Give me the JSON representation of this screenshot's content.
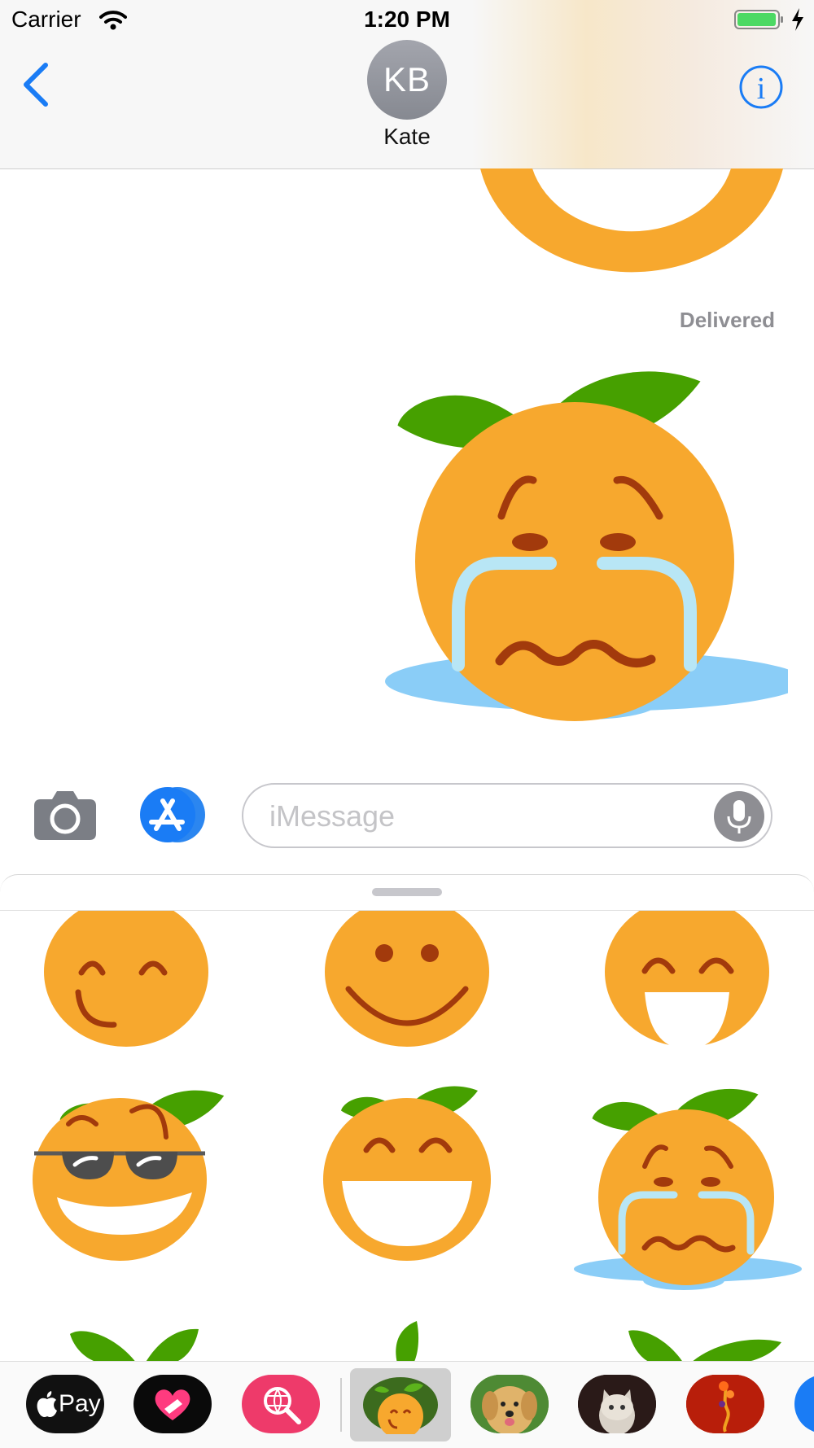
{
  "status_bar": {
    "carrier": "Carrier",
    "time": "1:20 PM"
  },
  "header": {
    "avatar_initials": "KB",
    "contact_name": "Kate"
  },
  "conversation": {
    "delivery_status": "Delivered"
  },
  "compose": {
    "placeholder": "iMessage",
    "value": ""
  },
  "app_strip": {
    "apple_pay_label": "Pay"
  },
  "colors": {
    "accent": "#1a7cf5",
    "orange": "#f7a82e",
    "leaf": "#46a000",
    "feature_brown": "#a23a0c",
    "tear": "#b8e6f5",
    "puddle": "#8acdf7"
  },
  "icons": [
    "wifi-icon",
    "battery-icon",
    "charging-bolt-icon",
    "back-chevron-icon",
    "info-icon",
    "camera-icon",
    "app-store-icon",
    "microphone-icon",
    "apple-logo-icon",
    "heart-icon",
    "search-globe-icon"
  ]
}
